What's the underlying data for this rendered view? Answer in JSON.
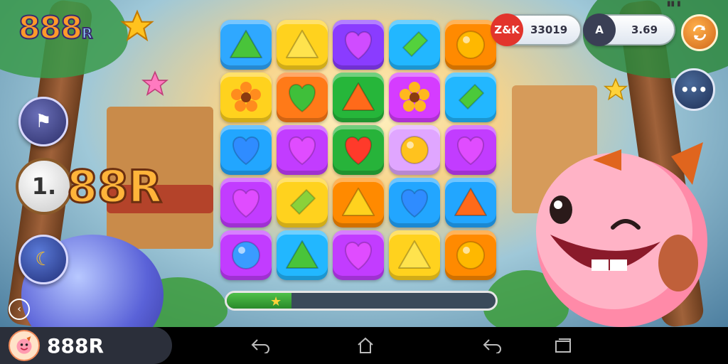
{
  "logo": {
    "text": "888",
    "suffix": "R"
  },
  "left_buttons": [
    {
      "name": "trophy-button",
      "glyph": "⚑"
    },
    {
      "name": "bunny-button",
      "glyph": "☾"
    }
  ],
  "brand": {
    "coin": "1.",
    "text": "88R"
  },
  "score_pills": [
    {
      "badge": "Z&K",
      "value": "33019",
      "badge_color": "#e2342c"
    },
    {
      "badge": "A",
      "value": "3.69",
      "badge_color": "#3a3f55"
    }
  ],
  "board": {
    "rows": 5,
    "cols": 5,
    "tiles": [
      [
        {
          "bg": "#2fa8ff",
          "shape": "triangle",
          "color": "#49c43a"
        },
        {
          "bg": "#ffd21e",
          "shape": "triangle",
          "color": "#ffe34d"
        },
        {
          "bg": "#8a3cff",
          "shape": "heart",
          "color": "#d04cff"
        },
        {
          "bg": "#22b7ff",
          "shape": "diamond",
          "color": "#54d13c"
        },
        {
          "bg": "#ff8a00",
          "shape": "circle",
          "color": "#ffb800"
        }
      ],
      [
        {
          "bg": "#ffd21e",
          "shape": "flower",
          "color": "#ff8c1e"
        },
        {
          "bg": "#ff7a18",
          "shape": "heart",
          "color": "#3fbf3a"
        },
        {
          "bg": "#26b63a",
          "shape": "triangle",
          "color": "#ff6a1a"
        },
        {
          "bg": "#d53cff",
          "shape": "flower",
          "color": "#ffb81e"
        },
        {
          "bg": "#22b7ff",
          "shape": "diamond",
          "color": "#4bc93a"
        }
      ],
      [
        {
          "bg": "#22a6ff",
          "shape": "heart",
          "color": "#2f8cff"
        },
        {
          "bg": "#c23cff",
          "shape": "heart",
          "color": "#e04cff"
        },
        {
          "bg": "#27b33a",
          "shape": "heart",
          "color": "#ff3a2a"
        },
        {
          "bg": "#e0a6ff",
          "shape": "circle",
          "color": "#ffc21e"
        },
        {
          "bg": "#c23cff",
          "shape": "heart",
          "color": "#e04cff"
        }
      ],
      [
        {
          "bg": "#c23cff",
          "shape": "heart",
          "color": "#e04cff"
        },
        {
          "bg": "#ffd21e",
          "shape": "diamond",
          "color": "#8ad13a"
        },
        {
          "bg": "#ff8a00",
          "shape": "triangle",
          "color": "#ffd21e"
        },
        {
          "bg": "#22a6ff",
          "shape": "heart",
          "color": "#2f8cff"
        },
        {
          "bg": "#22a6ff",
          "shape": "triangle",
          "color": "#ff6a1a"
        }
      ],
      [
        {
          "bg": "#c23cff",
          "shape": "circle",
          "color": "#3a9cff"
        },
        {
          "bg": "#22b7ff",
          "shape": "triangle",
          "color": "#49c43a"
        },
        {
          "bg": "#c23cff",
          "shape": "heart",
          "color": "#e04cff"
        },
        {
          "bg": "#ffd21e",
          "shape": "triangle",
          "color": "#ffe34d"
        },
        {
          "bg": "#ff8a00",
          "shape": "circle",
          "color": "#ffb800"
        }
      ]
    ]
  },
  "progress": {
    "fraction": 0.24
  },
  "app": {
    "name": "888R"
  },
  "nav": [
    "back-icon",
    "home-icon",
    "back-alt-icon",
    "recents-icon"
  ],
  "colors": {
    "accent": "#ffb43a",
    "progress": "#3fae3a"
  }
}
